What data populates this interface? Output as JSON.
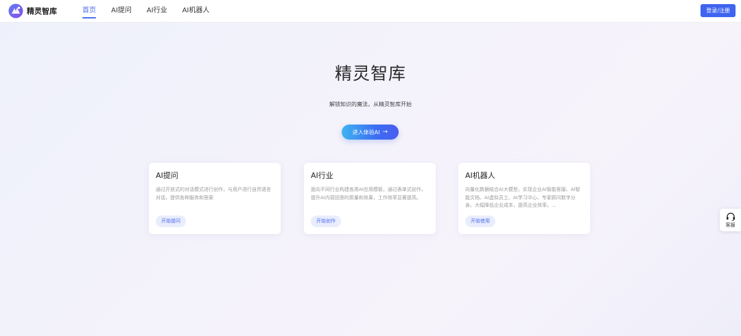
{
  "header": {
    "logo_text": "精灵智库",
    "nav": [
      {
        "label": "首页",
        "active": true
      },
      {
        "label": "AI提问",
        "active": false
      },
      {
        "label": "AI行业",
        "active": false
      },
      {
        "label": "AI机器人",
        "active": false
      }
    ],
    "login_label": "登录/注册"
  },
  "hero": {
    "title": "精灵智库",
    "subtitle": "解锁知识的魔法，从精灵智库开始",
    "cta_label": "进入体验AI"
  },
  "cards": [
    {
      "title": "AI提问",
      "description": "通过开放式的对话模式进行创作，与用户进行自然语言对话，提供各种服务和答案",
      "button": "开始提问"
    },
    {
      "title": "AI行业",
      "description": "面向不同行业构建各类AI应用模板，通过表单式创作，提升AI内容回答的质量和效果，工作效率显著提高。",
      "button": "开始创作"
    },
    {
      "title": "AI机器人",
      "description": "向量化数据结合AI大模型，实现企业AI智能客服、AI智能文档、AI虚拟员工、AI学习中心、专家顾问数字分身。大幅降低企业成本，提高企业效率。...",
      "button": "开始使用"
    }
  ],
  "service_widget": {
    "label": "客服"
  },
  "colors": {
    "accent": "#4f6cf0",
    "login_button": "#3f64f0",
    "cta_gradient_start": "#3fb4f0",
    "cta_gradient_end": "#4a5cf0"
  }
}
